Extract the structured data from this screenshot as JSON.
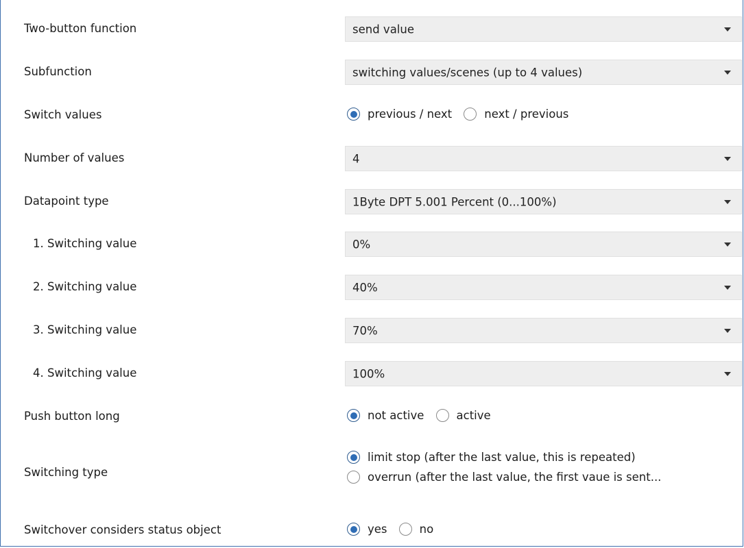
{
  "rows": {
    "two_button_function": {
      "label": "Two-button function",
      "value": "send value"
    },
    "subfunction": {
      "label": "Subfunction",
      "value": "switching values/scenes (up to 4 values)"
    },
    "switch_values": {
      "label": "Switch values",
      "options": [
        "previous / next",
        "next / previous"
      ],
      "selected": "previous / next"
    },
    "number_of_values": {
      "label": "Number of values",
      "value": "4"
    },
    "datapoint_type": {
      "label": "Datapoint type",
      "value": "1Byte DPT 5.001 Percent (0...100%)"
    },
    "switching_value_1": {
      "label": "1. Switching value",
      "value": "0%"
    },
    "switching_value_2": {
      "label": "2. Switching value",
      "value": "40%"
    },
    "switching_value_3": {
      "label": "3. Switching value",
      "value": "70%"
    },
    "switching_value_4": {
      "label": "4. Switching value",
      "value": "100%"
    },
    "push_button_long": {
      "label": "Push button long",
      "options": [
        "not active",
        "active"
      ],
      "selected": "not active"
    },
    "switching_type": {
      "label": "Switching type",
      "options": [
        "limit stop (after the last value, this is repeated)",
        "overrun (after the last value, the first vaue is sent..."
      ],
      "selected": "limit stop (after the last value, this is repeated)"
    },
    "switchover_status": {
      "label": "Switchover considers status object",
      "options": [
        "yes",
        "no"
      ],
      "selected": "yes"
    }
  },
  "icons": {
    "dropdown": "chevron-down-icon",
    "radio": "radio-icon"
  }
}
